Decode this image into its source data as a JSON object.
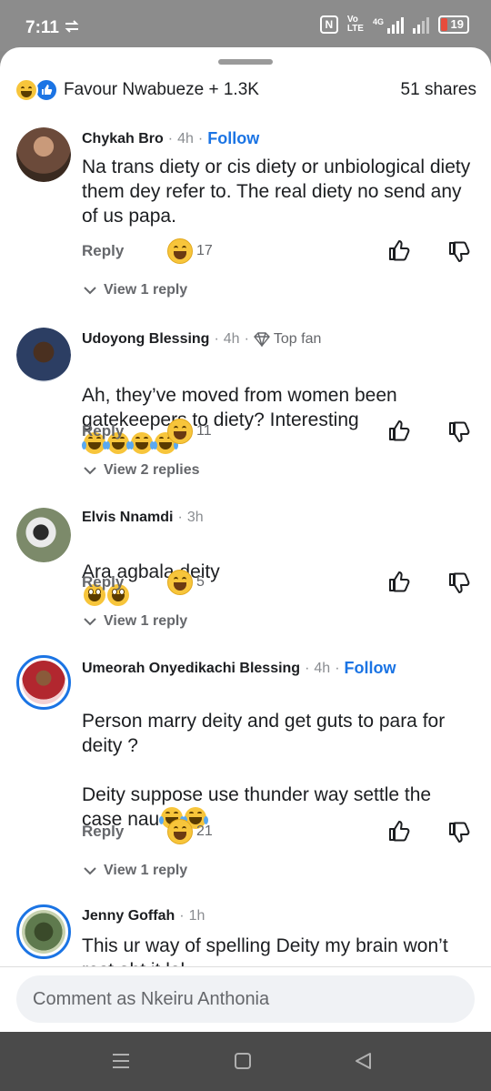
{
  "status_bar": {
    "time": "7:11",
    "sync_icon": "sync-icon",
    "volte": "Vo\nLTE",
    "network": "4G",
    "battery": "19"
  },
  "post_summary": {
    "reactors": "Favour Nwabueze + 1.3K",
    "shares": "51 shares"
  },
  "comments": [
    {
      "author": "Chykah Bro",
      "time": "4h",
      "badge": "Follow",
      "text": "Na trans diety or cis diety or unbiological diety them dey refer to. The real diety no send any of us papa.",
      "emojis": [],
      "reply_label": "Reply",
      "reaction_count": "17",
      "view_replies": "View 1 reply",
      "avatar_color": "#6b4a3a"
    },
    {
      "author": "Udoyong Blessing",
      "time": "4h",
      "badge": "Top fan",
      "text": "Ah, they’ve moved from women been gatekeepers to diety? Interesting",
      "emojis": [
        "tears",
        "tears",
        "tears",
        "tears"
      ],
      "reply_label": "Reply",
      "reaction_count": "11",
      "view_replies": "View 2 replies",
      "avatar_color": "#2c3e63"
    },
    {
      "author": "Elvis Nnamdi",
      "time": "3h",
      "badge": "",
      "text": "Ara agbala deity",
      "emojis": [
        "grin",
        "grin"
      ],
      "reply_label": "Reply",
      "reaction_count": "5",
      "view_replies": "View 1 reply",
      "avatar_color": "#7c8a6a"
    },
    {
      "author": "Umeorah Onyedikachi Blessing",
      "time": "4h",
      "badge": "Follow",
      "text": "Person marry deity and get guts to para for deity ?\n\nDeity suppose use thunder way settle the case nau",
      "emojis": [
        "tears",
        "tears"
      ],
      "reply_label": "Reply",
      "reaction_count": "21",
      "view_replies": "View 1 reply",
      "avatar_color": "#b2272f"
    },
    {
      "author": "Jenny Goffah",
      "time": "1h",
      "badge": "",
      "text": "This ur way of spelling Deity my brain won’t rest abt it lol",
      "emojis": [],
      "reply_label": "",
      "reaction_count": "",
      "view_replies": "",
      "avatar_color": "#5f7a4e"
    }
  ],
  "composer": {
    "placeholder": "Comment as Nkeiru Anthonia"
  },
  "nav": {
    "items": [
      "menu-icon",
      "home-icon",
      "back-icon"
    ]
  }
}
